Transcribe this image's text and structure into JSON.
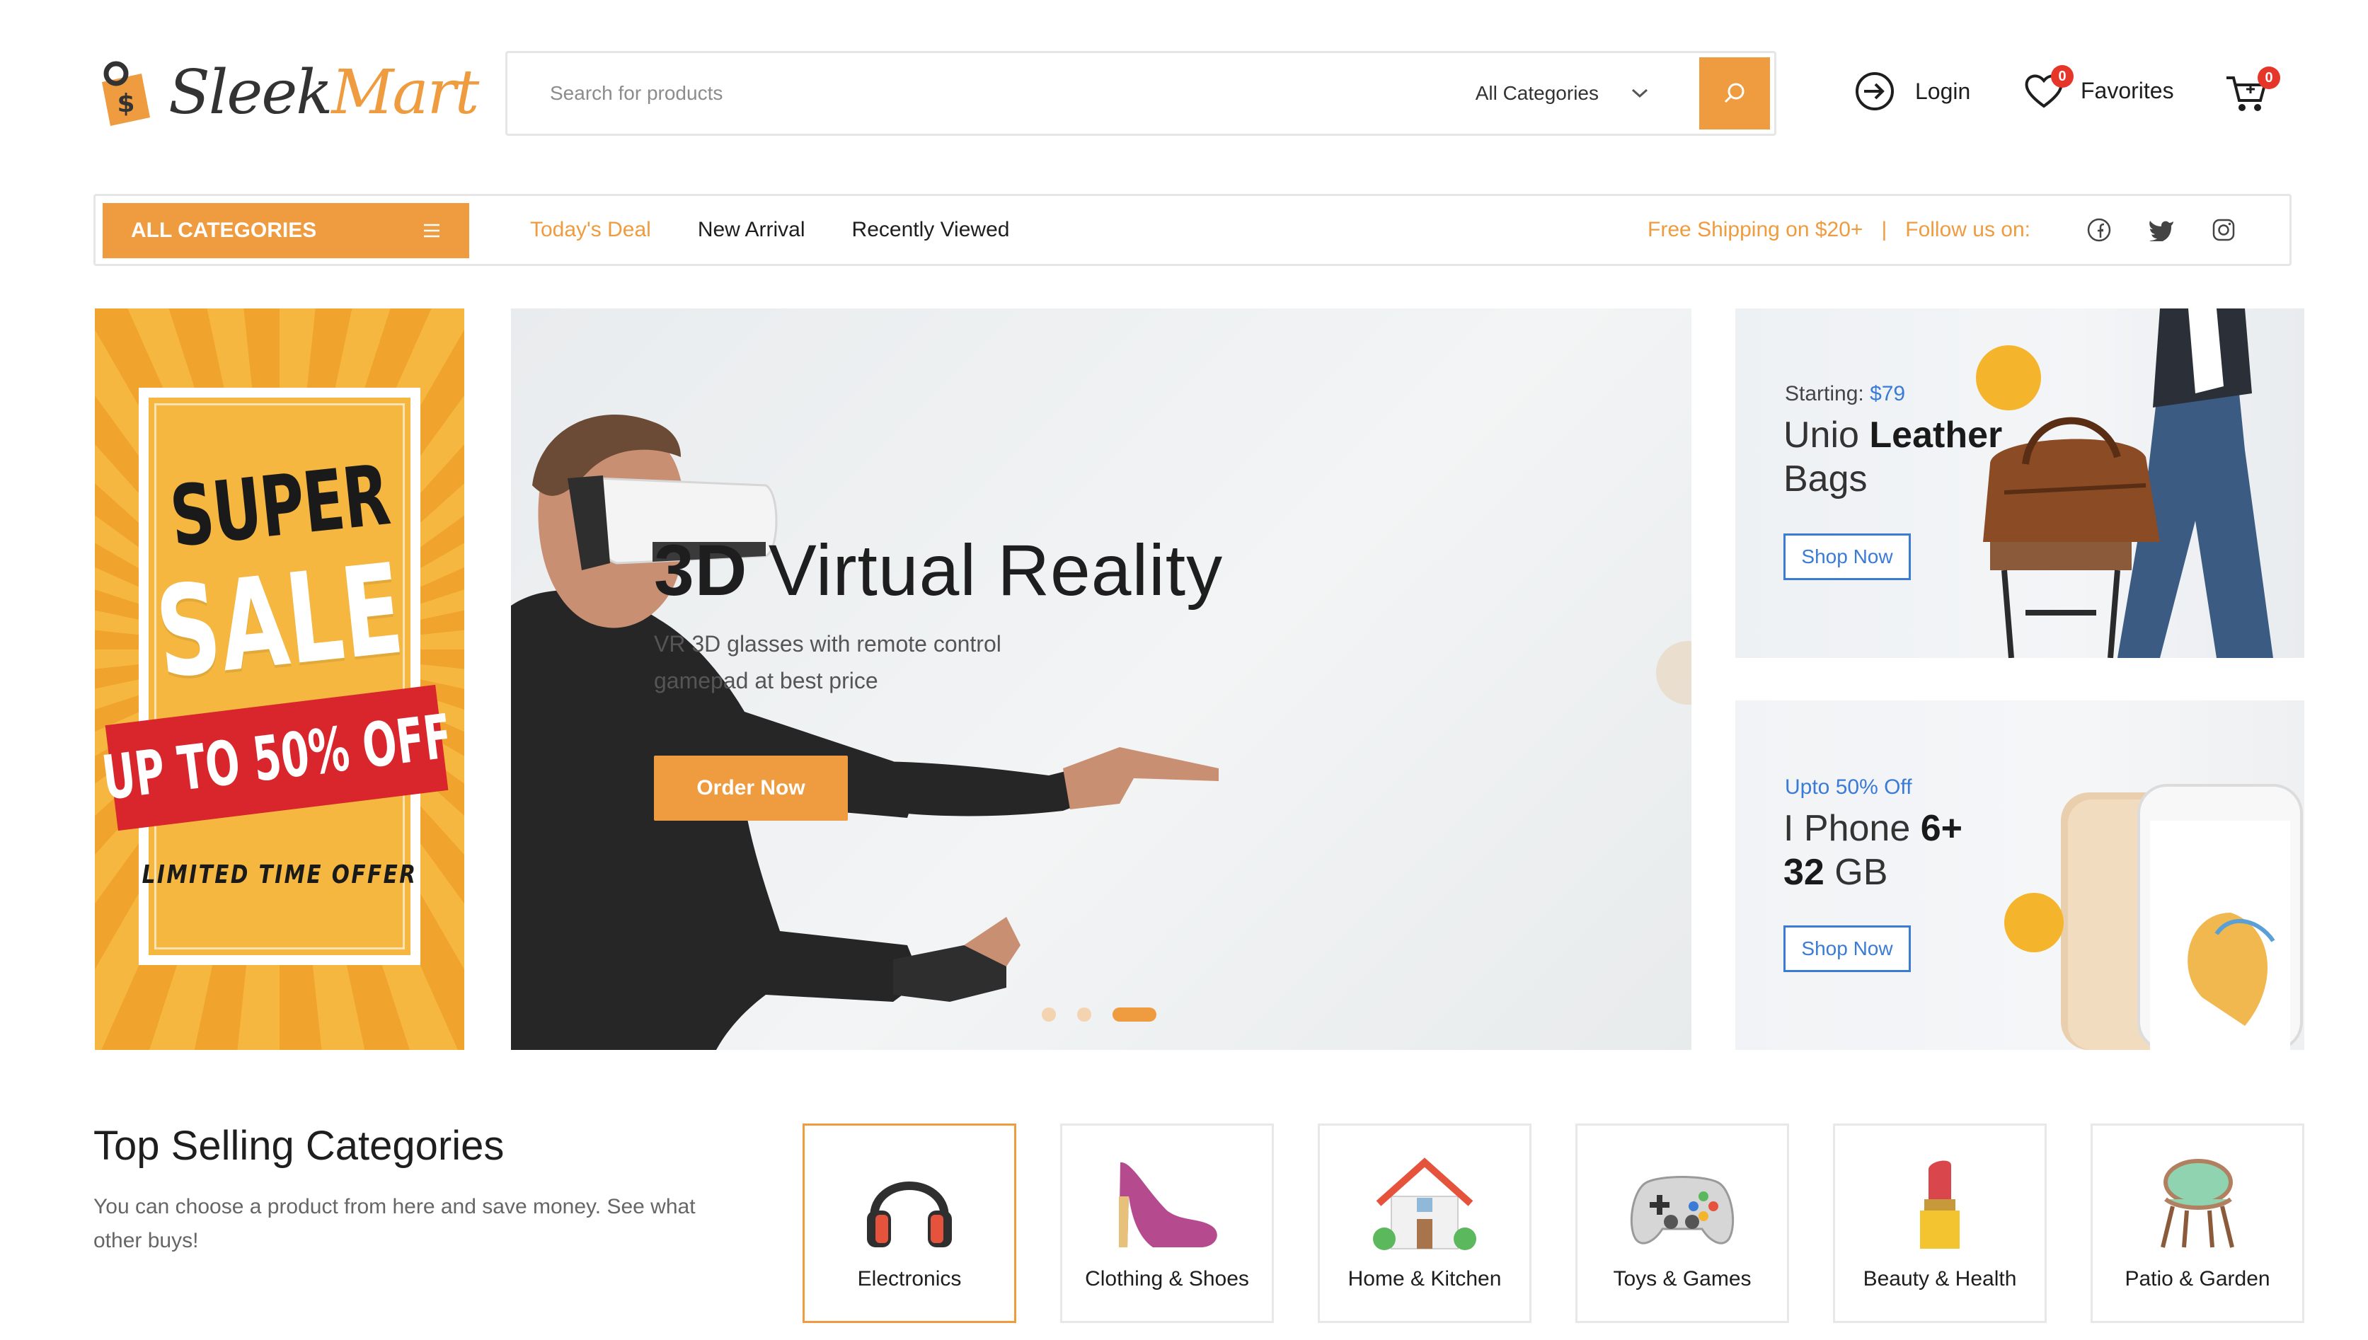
{
  "brand": {
    "name_part1": "Sleek",
    "name_part2": "Mart"
  },
  "search": {
    "placeholder": "Search for products",
    "category": "All Categories"
  },
  "header": {
    "login_label": "Login",
    "favorites_label": "Favorites",
    "favorites_count": "0",
    "cart_count": "0"
  },
  "nav": {
    "all_categories": "ALL CATEGORIES",
    "links": [
      "Today's Deal",
      "New Arrival",
      "Recently Viewed"
    ],
    "shipping": "Free Shipping on $20+",
    "separator": "|",
    "follow": "Follow us on:"
  },
  "sale_banner": {
    "super": "SUPER",
    "sale": "SALE",
    "discount": "UP TO 50% OFF",
    "limited": "LIMITED TIME OFFER"
  },
  "hero": {
    "title_bold": "3D",
    "title_rest": " Virtual Reality",
    "subtitle_line1": "VR 3D glasses with remote control",
    "subtitle_line2": "gamepad at best price",
    "button": "Order Now",
    "slides_total": 3,
    "active_slide": 3
  },
  "promo1": {
    "tag_prefix": "Starting: ",
    "price": "$79",
    "title_line1_light": "Unio ",
    "title_line1_bold": "Leather",
    "title_line2": "Bags",
    "button": "Shop Now"
  },
  "promo2": {
    "tag": "Upto 50% Off",
    "title_line1_light": "I Phone ",
    "title_line1_bold": "6+",
    "title_line2_bold": "32",
    "title_line2_light": " GB",
    "button": "Shop Now"
  },
  "top_selling": {
    "title": "Top Selling Categories",
    "description": "You can choose a product from here and save money. See what other buys!",
    "categories": [
      {
        "label": "Electronics",
        "icon": "headphones-icon"
      },
      {
        "label": "Clothing & Shoes",
        "icon": "high-heel-icon"
      },
      {
        "label": "Home & Kitchen",
        "icon": "house-icon"
      },
      {
        "label": "Toys & Games",
        "icon": "gamepad-icon"
      },
      {
        "label": "Beauty & Health",
        "icon": "lipstick-icon"
      },
      {
        "label": "Patio & Garden",
        "icon": "chair-icon"
      }
    ]
  },
  "colors": {
    "accent": "#ee9c3f",
    "link_blue": "#3a7bd5",
    "badge_red": "#e63529",
    "border": "#e6e6e6"
  }
}
